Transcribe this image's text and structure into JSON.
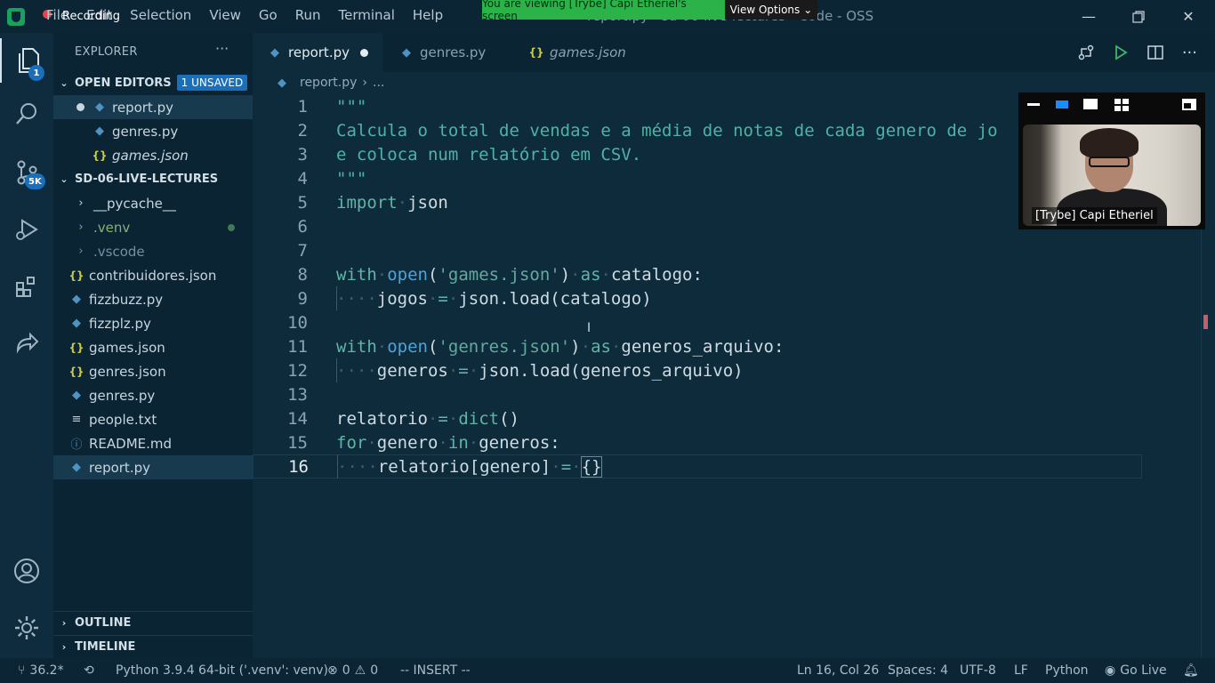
{
  "recording_label": "Recording",
  "menu": [
    "File",
    "Edit",
    "Selection",
    "View",
    "Go",
    "Run",
    "Terminal",
    "Help"
  ],
  "window_title": "report.py - sd-06-live-lectures - Code - OSS",
  "share_banner": "You are viewing [Trybe] Capi Etheriel's screen",
  "view_options_label": "View Options",
  "activity_badges": {
    "explorer": "1",
    "scm": "5K"
  },
  "explorer": {
    "title": "EXPLORER",
    "more": "···",
    "open_editors": {
      "title": "OPEN EDITORS",
      "badge": "1 UNSAVED",
      "items": [
        "report.py",
        "genres.py",
        "games.json"
      ]
    },
    "folder": {
      "title": "SD-06-LIVE-LECTURES",
      "items": [
        "__pycache__",
        ".venv",
        ".vscode",
        "contribuidores.json",
        "fizzbuzz.py",
        "fizzplz.py",
        "games.json",
        "genres.json",
        "genres.py",
        "people.txt",
        "README.md",
        "report.py"
      ]
    },
    "outline": "OUTLINE",
    "timeline": "TIMELINE"
  },
  "tabs": [
    "report.py",
    "genres.py",
    "games.json"
  ],
  "breadcrumb": {
    "file": "report.py",
    "rest": "..."
  },
  "code": {
    "line_numbers": [
      "1",
      "2",
      "3",
      "4",
      "5",
      "6",
      "7",
      "8",
      "9",
      "10",
      "11",
      "12",
      "13",
      "14",
      "15",
      "16"
    ],
    "l1": "\"\"\"",
    "l2": "Calcula o total de vendas e a média de notas de cada genero de jo",
    "l3": "e coloca num relatório em CSV.",
    "l4": "\"\"\"",
    "l5_kw": "import",
    "l5_mod": "json",
    "l8_with": "with",
    "l8_open": "open",
    "l8_str": "'games.json'",
    "l8_as": "as",
    "l8_var": "catalogo:",
    "l9_var": "jogos",
    "l9_call": "json.load(catalogo)",
    "l11_with": "with",
    "l11_open": "open",
    "l11_str": "'genres.json'",
    "l11_as": "as",
    "l11_var": "generos_arquivo:",
    "l12_var": "generos",
    "l12_call": "json.load(generos_arquivo)",
    "l14_var": "relatorio",
    "l14_call": "dict",
    "l15_for": "for",
    "l15_var": "genero",
    "l15_in": "in",
    "l15_iter": "generos:",
    "l16_expr": "relatorio[genero]",
    "l16_val": "{}"
  },
  "video": {
    "label": "[Trybe] Capi Etheriel"
  },
  "status": {
    "branch": "36.2*",
    "interpreter": "Python 3.9.4 64-bit ('.venv': venv)",
    "errors": "0",
    "warnings": "0",
    "mode": "-- INSERT --",
    "position": "Ln 16, Col 26",
    "spaces": "Spaces: 4",
    "encoding": "UTF-8",
    "eol": "LF",
    "language": "Python",
    "golive": "Go Live"
  },
  "colors": {
    "background": "#0e2b3b",
    "sidebar": "#0b2433",
    "accent": "#1b6fba",
    "banner": "#2bb34a"
  }
}
